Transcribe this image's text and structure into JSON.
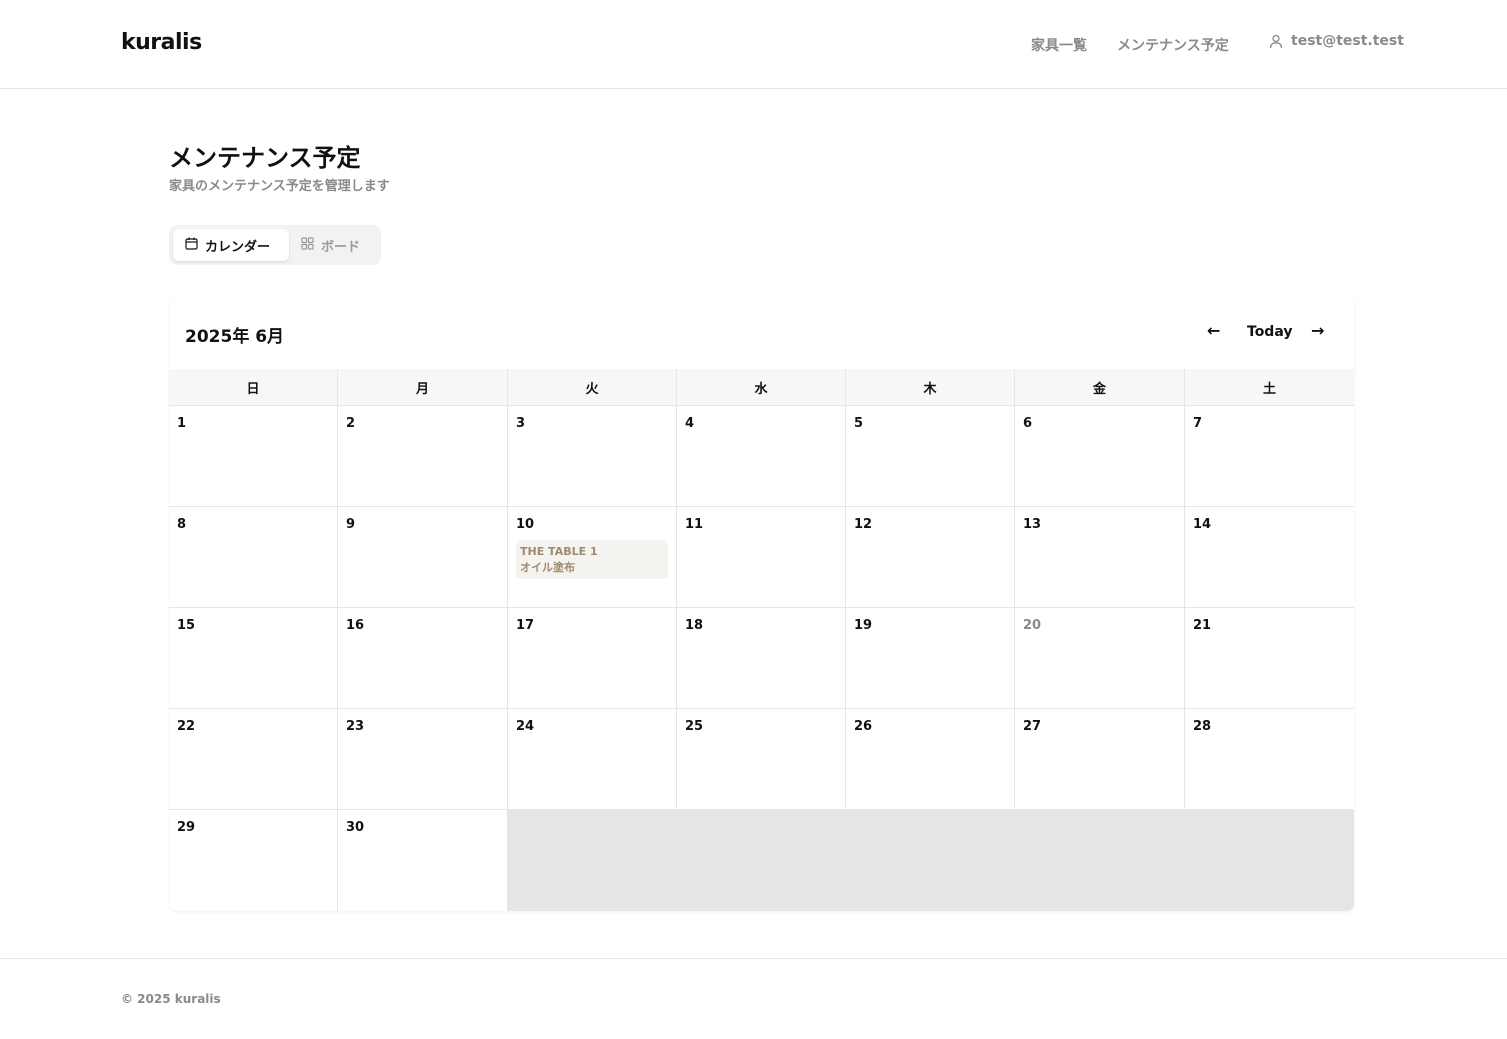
{
  "header": {
    "logo": "kuralis",
    "nav": {
      "furniture": "家具一覧",
      "maintenance": "メンテナンス予定"
    },
    "user": "test@test.test"
  },
  "page": {
    "title": "メンテナンス予定",
    "subtitle": "家具のメンテナンス予定を管理します"
  },
  "view_toggle": {
    "calendar": "カレンダー",
    "board": "ボード",
    "active": "calendar"
  },
  "calendar": {
    "month_label": "2025年 6月",
    "prev": "←",
    "today": "Today",
    "next": "→",
    "weekdays": [
      "日",
      "月",
      "火",
      "水",
      "木",
      "金",
      "土"
    ],
    "days": [
      "1",
      "2",
      "3",
      "4",
      "5",
      "6",
      "7",
      "8",
      "9",
      "10",
      "11",
      "12",
      "13",
      "14",
      "15",
      "16",
      "17",
      "18",
      "19",
      "20",
      "21",
      "22",
      "23",
      "24",
      "25",
      "26",
      "27",
      "28",
      "29",
      "30"
    ],
    "today_date": "20",
    "event": {
      "day": "10",
      "title": "THE TABLE 1",
      "task": "オイル塗布"
    }
  },
  "footer": {
    "copyright": "© 2025 kuralis"
  },
  "colors": {
    "event_bg": "#f5f3ef",
    "event_text": "#a08a6e",
    "muted": "#8a8a8a"
  }
}
